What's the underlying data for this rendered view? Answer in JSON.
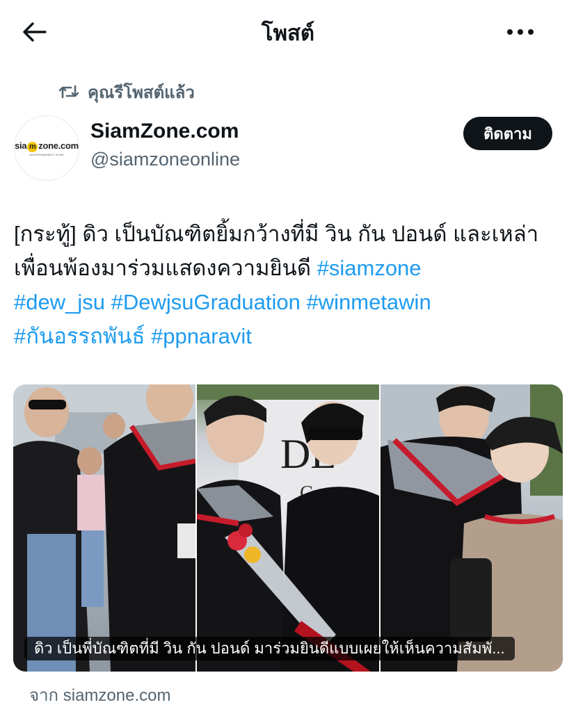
{
  "header": {
    "title": "โพสต์",
    "back_icon": "arrow-left-icon",
    "more_icon": "more-horizontal-icon"
  },
  "repost": {
    "icon": "repost-icon",
    "label": "คุณรีโพสต์แล้ว"
  },
  "author": {
    "name": "SiamZone.com",
    "handle": "@siamzoneonline",
    "avatar_logo": {
      "before": "sia",
      "mark": "m",
      "after": "zone.com",
      "tagline": "ENTERTAINMENT ZONE"
    },
    "follow_label": "ติดตาม"
  },
  "post": {
    "text_prefix": "[กระทู้] ดิว เป็นบัณฑิตยิ้มกว้างที่มี วิน กัน ปอนด์ และเหล่าเพื่อนพ้องมาร่วมแสดงความยินดี ",
    "hashtags": [
      "#siamzone",
      "#dew_jsu",
      "#DewjsuGraduation",
      "#winmetawin",
      "#กันอรรถพันธ์",
      "#ppnaravit"
    ]
  },
  "card": {
    "caption": "ดิว เป็นพี่บัณฑิตที่มี วิน กัน ปอนด์ มาร่วมยินดีแบบเผยให้เห็นความสัมพั...",
    "source": "จาก siamzone.com",
    "bg_text": "DE",
    "bg_text2": "Gra"
  },
  "colors": {
    "link": "#1d9bf0",
    "secondary": "#536471",
    "primary": "#0f1419",
    "gown_red": "#c61b2b"
  }
}
